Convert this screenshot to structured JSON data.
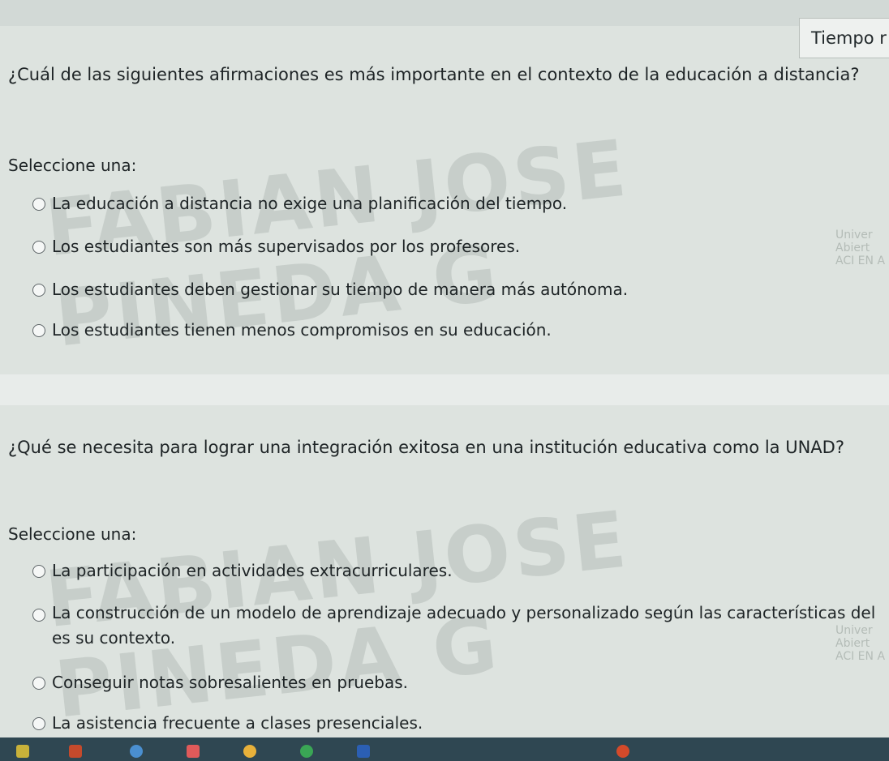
{
  "timer": {
    "label": "Tiempo r"
  },
  "questions": [
    {
      "prompt": "¿Cuál de las siguientes afirmaciones es más importante en el contexto de la educación a distancia?",
      "select_label": "Seleccione una:",
      "options": [
        "La educación a distancia no exige una planificación del tiempo.",
        "Los estudiantes son más supervisados por los profesores.",
        "Los estudiantes deben gestionar su tiempo de manera más autónoma.",
        "Los estudiantes tienen menos compromisos en su educación."
      ]
    },
    {
      "prompt": "¿Qué se necesita para lograr una integración exitosa en una institución educativa como la UNAD?",
      "select_label": "Seleccione una:",
      "options": [
        "La participación en actividades extracurriculares.",
        "La construcción de un modelo de aprendizaje adecuado y personalizado según las características del es su contexto.",
        "Conseguir notas sobresalientes en pruebas.",
        "La asistencia frecuente a clases presenciales."
      ]
    }
  ],
  "watermark": {
    "line1": "FABIAN JOSE PINEDA G",
    "logo_text": "Univer Abiert ACI EN A"
  },
  "colors": {
    "page": "#dde3df",
    "taskbar": "#2f4752"
  }
}
